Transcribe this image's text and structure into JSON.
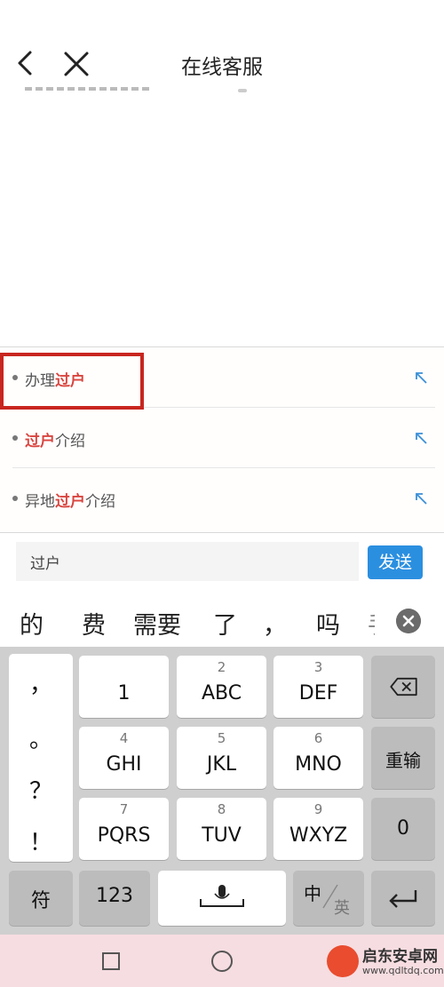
{
  "header": {
    "title": "在线客服"
  },
  "suggestions": [
    {
      "prefix": "办理",
      "highlight": "过户",
      "suffix": ""
    },
    {
      "prefix": "",
      "highlight": "过户",
      "suffix": "介绍"
    },
    {
      "prefix": "异地",
      "highlight": "过户",
      "suffix": "介绍"
    }
  ],
  "input": {
    "value": "过户",
    "send_label": "发送"
  },
  "candidates": [
    "的",
    "费",
    "需要",
    "了",
    "，",
    "吗",
    "手"
  ],
  "keyboard": {
    "punct": [
      "，",
      "。",
      "？",
      "！"
    ],
    "keys": [
      {
        "num": "",
        "label": "1"
      },
      {
        "num": "2",
        "label": "ABC"
      },
      {
        "num": "3",
        "label": "DEF"
      },
      {
        "num": "4",
        "label": "GHI"
      },
      {
        "num": "5",
        "label": "JKL"
      },
      {
        "num": "6",
        "label": "MNO"
      },
      {
        "num": "7",
        "label": "PQRS"
      },
      {
        "num": "8",
        "label": "TUV"
      },
      {
        "num": "9",
        "label": "WXYZ"
      }
    ],
    "reinput_label": "重输",
    "zero_label": "0",
    "symbol_label": "符",
    "numeric_label": "123",
    "lang_zh": "中",
    "lang_en": "英"
  },
  "watermark": {
    "name": "启东安卓网",
    "url": "www.qdltdq.com"
  },
  "colors": {
    "highlight": "#d9453f",
    "send_button": "#2b8fe0",
    "annotation_box": "#c8261f"
  }
}
